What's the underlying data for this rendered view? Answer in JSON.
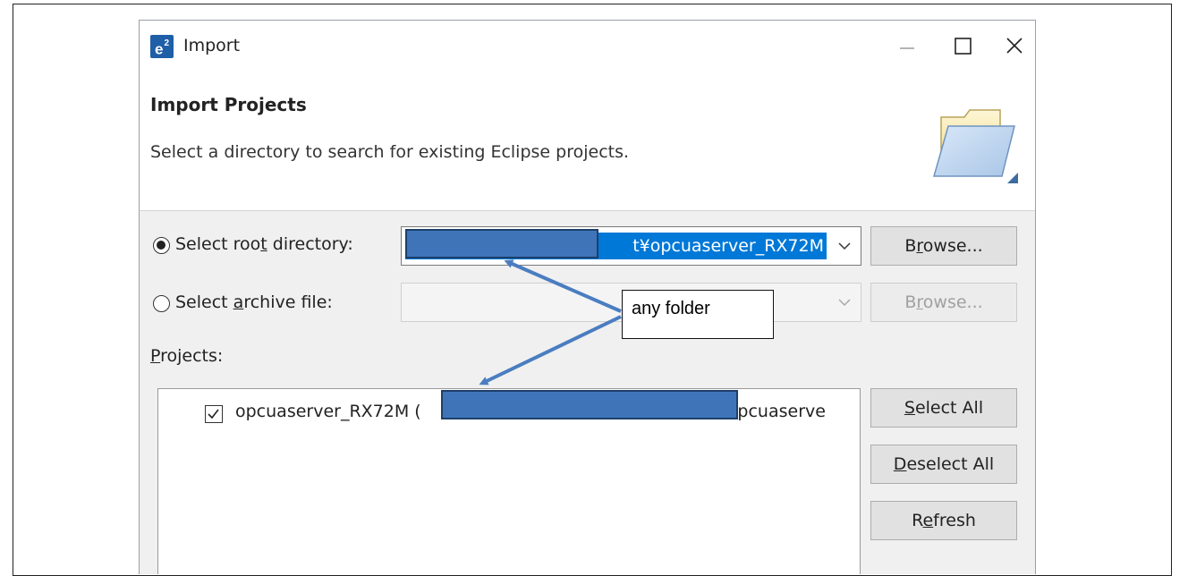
{
  "window": {
    "app_icon_text": "e",
    "app_icon_sup": "2",
    "title": "Import",
    "controls": {
      "minimize": "—",
      "maximize": "☐",
      "close": "✕"
    }
  },
  "header": {
    "title": "Import Projects",
    "description": "Select a directory to search for existing Eclipse projects.",
    "icon": "folder-icon"
  },
  "root_directory": {
    "label_pre": "Select roo",
    "label_mnemonic": "t",
    "label_post": " directory:",
    "selected": true,
    "value_visible": "t¥opcuaserver_RX72M",
    "browse_pre": "B",
    "browse_mnemonic": "r",
    "browse_post": "owse..."
  },
  "archive_file": {
    "label_pre": "Select ",
    "label_mnemonic": "a",
    "label_post": "rchive file:",
    "selected": false,
    "value": "",
    "browse_pre": "B",
    "browse_mnemonic": "r",
    "browse_post": "owse..."
  },
  "projects": {
    "label_mnemonic": "P",
    "label_post": "rojects:",
    "items": [
      {
        "checked": true,
        "name_pre": "opcuaserver_RX72M (",
        "path_suffix": "¥opcuaserve"
      }
    ]
  },
  "side_buttons": {
    "select_all_mnemonic": "S",
    "select_all_post": "elect All",
    "deselect_all_mnemonic": "D",
    "deselect_all_post": "eselect All",
    "refresh_pre": "R",
    "refresh_mnemonic": "e",
    "refresh_post": "fresh"
  },
  "annotation": {
    "callout_text": "any folder",
    "color": "#4a7dc0"
  }
}
